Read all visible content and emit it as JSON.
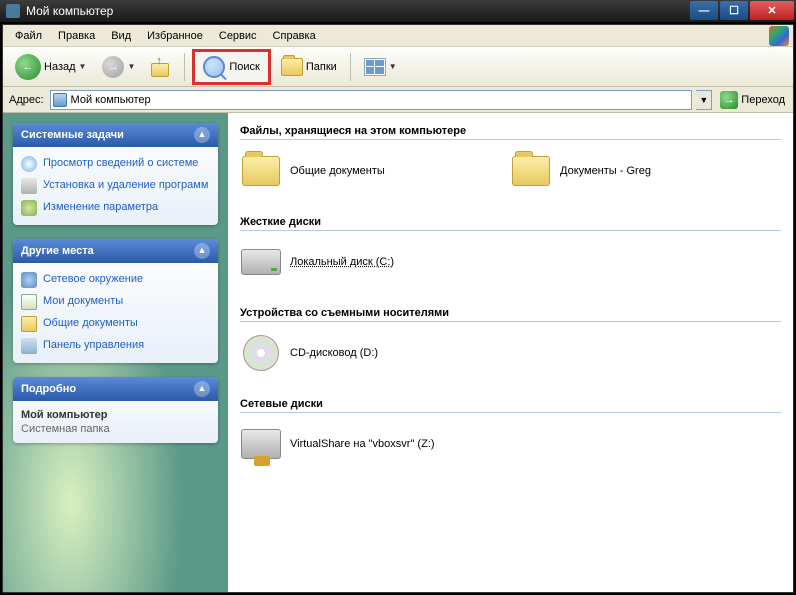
{
  "window": {
    "title": "Мой компьютер"
  },
  "menu": {
    "file": "Файл",
    "edit": "Правка",
    "view": "Вид",
    "favorites": "Избранное",
    "tools": "Сервис",
    "help": "Справка"
  },
  "toolbar": {
    "back": "Назад",
    "search": "Поиск",
    "folders": "Папки"
  },
  "address": {
    "label": "Адрес:",
    "value": "Мой компьютер",
    "go": "Переход"
  },
  "sidebar": {
    "panels": [
      {
        "title": "Системные задачи",
        "items": [
          {
            "label": "Просмотр сведений о системе"
          },
          {
            "label": "Установка и удаление программ"
          },
          {
            "label": "Изменение параметра"
          }
        ]
      },
      {
        "title": "Другие места",
        "items": [
          {
            "label": "Сетевое окружение"
          },
          {
            "label": "Мои документы"
          },
          {
            "label": "Общие документы"
          },
          {
            "label": "Панель управления"
          }
        ]
      },
      {
        "title": "Подробно",
        "info": {
          "name": "Мой компьютер",
          "type": "Системная папка"
        }
      }
    ]
  },
  "content": {
    "groups": [
      {
        "header": "Файлы, хранящиеся на этом компьютере",
        "items": [
          {
            "label": "Общие документы",
            "kind": "folder"
          },
          {
            "label": "Документы - Greg",
            "kind": "folder"
          }
        ]
      },
      {
        "header": "Жесткие диски",
        "items": [
          {
            "label": "Локальный диск (C:)",
            "kind": "hdd",
            "selected": true
          }
        ]
      },
      {
        "header": "Устройства со съемными носителями",
        "items": [
          {
            "label": "CD-дисковод (D:)",
            "kind": "cd"
          }
        ]
      },
      {
        "header": "Сетевые диски",
        "items": [
          {
            "label": "VirtualShare на \"vboxsvr\" (Z:)",
            "kind": "net"
          }
        ]
      }
    ]
  }
}
